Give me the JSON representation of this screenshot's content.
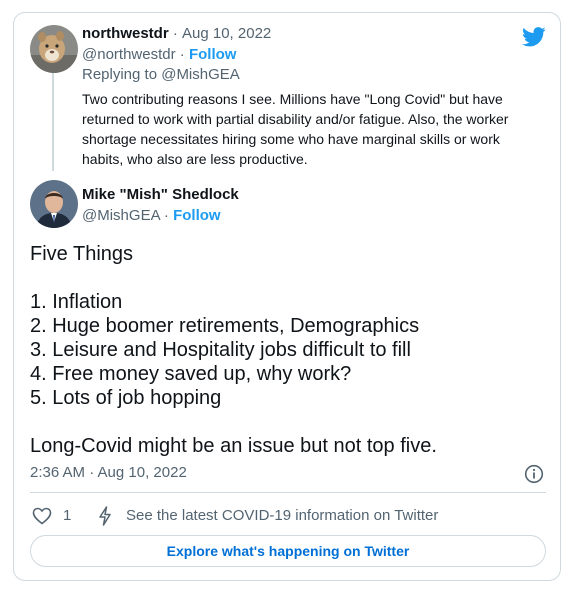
{
  "reply_tweet": {
    "display_name": "northwestdr",
    "separator": "·",
    "date": "Aug 10, 2022",
    "handle": "@northwestdr",
    "follow_label": "Follow",
    "replying_to": "Replying to @MishGEA",
    "text": "Two contributing reasons I see. Millions have \"Long Covid\" but have returned to work with partial disability and/or fatigue. Also, the worker shortage necessitates hiring some who have marginal skills or work habits, who also are less productive."
  },
  "main_tweet": {
    "display_name": "Mike \"Mish\" Shedlock",
    "handle": "@MishGEA",
    "separator": "·",
    "follow_label": "Follow",
    "lines": [
      "Five Things",
      "",
      "1. Inflation",
      "2. Huge boomer retirements, Demographics",
      "3. Leisure and Hospitality jobs difficult to fill",
      "4. Free money saved up, why work?",
      "5. Lots of job hopping",
      "",
      "Long-Covid might be an issue but not top five."
    ],
    "timestamp": "2:36 AM · Aug 10, 2022",
    "like_count": "1",
    "covid_info": "See the latest COVID-19 information on Twitter",
    "explore_label": "Explore what's happening on Twitter"
  },
  "icons": {
    "brand": "twitter-bird",
    "info": "info-circle",
    "like": "heart-outline",
    "covid": "lightning-bolt"
  },
  "colors": {
    "accent": "#1d9bf0",
    "link": "#006fd6",
    "muted": "#536471",
    "border": "#cfd9de"
  }
}
